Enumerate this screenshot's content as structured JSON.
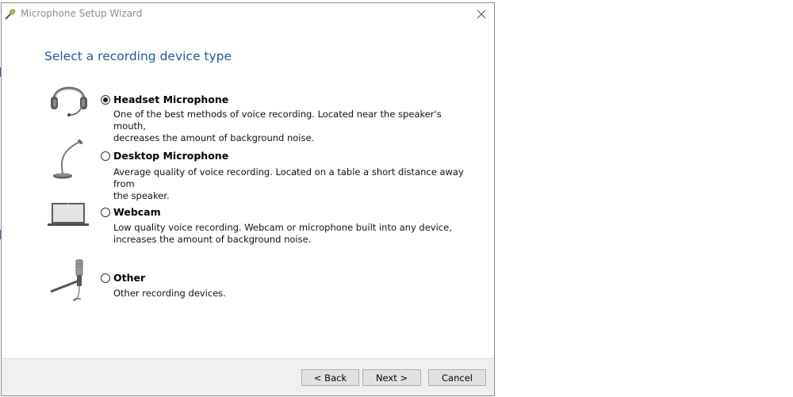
{
  "window": {
    "title": "Microphone Setup Wizard",
    "close_glyph": "✕"
  },
  "heading": "Select a recording device type",
  "options": [
    {
      "label": "Headset Microphone",
      "desc_line1": "One of the best methods of voice recording. Located near the speaker's mouth,",
      "desc_line2": "decreases the amount of background noise.",
      "checked": true,
      "icon": "headset-icon"
    },
    {
      "label": "Desktop Microphone",
      "desc_line1": "Average quality of voice recording. Located on a table a short distance away from",
      "desc_line2": "the speaker.",
      "checked": false,
      "icon": "desktop-microphone-icon"
    },
    {
      "label": "Webcam",
      "desc_line1": "Low quality voice recording. Webcam or microphone built into any device,",
      "desc_line2": "increases the amount of background noise.",
      "checked": false,
      "icon": "laptop-webcam-icon"
    },
    {
      "label": "Other",
      "desc_line1": "Other recording devices.",
      "checked": false,
      "icon": "stand-microphone-icon"
    }
  ],
  "buttons": {
    "back": "< Back",
    "next": "Next >",
    "cancel": "Cancel"
  },
  "colors": {
    "heading": "#1e5a9c",
    "footer_bg": "#f0f0f0",
    "button_bg": "#e1e1e1"
  }
}
